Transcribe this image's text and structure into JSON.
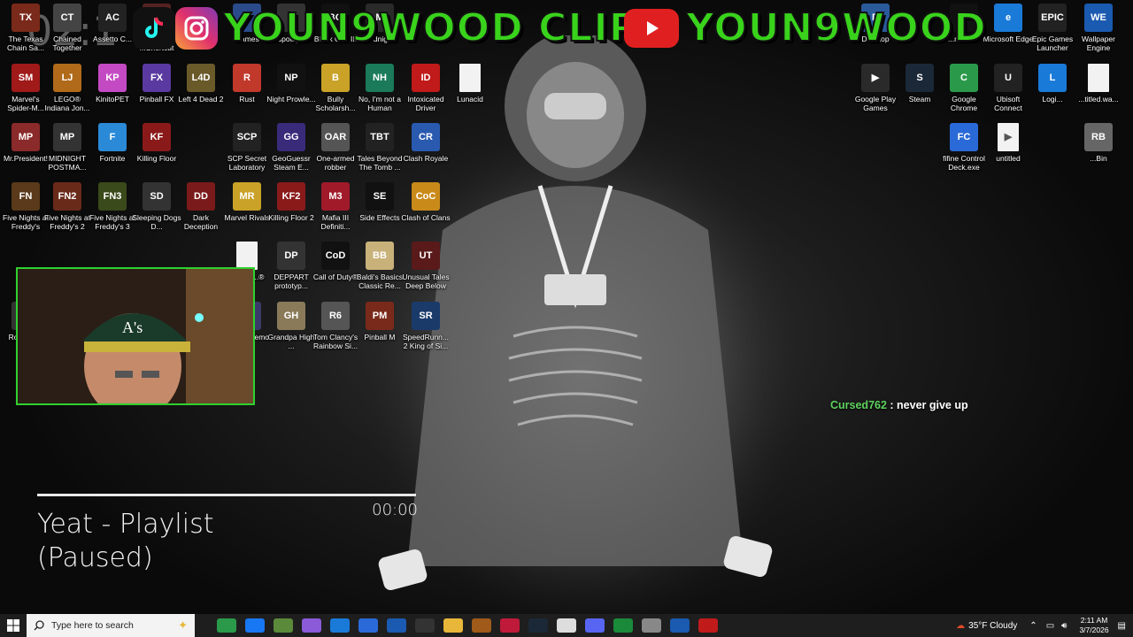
{
  "banner": {
    "brand_left": "YOUN9WOOD CLIPS",
    "brand_right": "YOUN9WOOD",
    "timer": "02:1"
  },
  "desktop_icons": [
    {
      "label": "The Texas Chain Sa...",
      "icon": "texas-chainsaw-icon",
      "color": "#7a2a1a",
      "abbr": "TX"
    },
    {
      "label": "Chained Together",
      "icon": "chained-together-icon",
      "color": "#444",
      "abbr": "CT"
    },
    {
      "label": "Assetto C...",
      "icon": "assetto-corsa-icon",
      "color": "#222",
      "abbr": "AC"
    },
    {
      "label": "Beat ...Shortcut",
      "icon": "beat-shortcut-icon",
      "color": "#552222",
      "abbr": "BS"
    },
    {
      "label": "Games",
      "icon": "games-folder-icon",
      "color": "#2a4a8a",
      "abbr": "G"
    },
    {
      "label": "Spotlight",
      "icon": "spotlight-icon",
      "color": "#333",
      "abbr": "S"
    },
    {
      "label": "Black Ops III",
      "icon": "black-ops-icon",
      "color": "#111",
      "abbr": "BO"
    },
    {
      "label": "Midnig...",
      "icon": "midnight-icon",
      "color": "#2a2a2a",
      "abbr": "M"
    },
    {
      "label": "Marvel's Spider-M...",
      "icon": "spiderman-icon",
      "color": "#a01a1a",
      "abbr": "SM"
    },
    {
      "label": "LEGO® Indiana Jon...",
      "icon": "lego-indiana-icon",
      "color": "#b06a1a",
      "abbr": "LJ"
    },
    {
      "label": "KinitoPET",
      "icon": "kinitopet-icon",
      "color": "#c44ac4",
      "abbr": "KP"
    },
    {
      "label": "Pinball FX",
      "icon": "pinball-fx-icon",
      "color": "#5a3aa0",
      "abbr": "FX"
    },
    {
      "label": "Left 4 Dead 2",
      "icon": "left4dead-icon",
      "color": "#6a5a2a",
      "abbr": "L4D"
    },
    {
      "label": "Rust",
      "icon": "rust-icon",
      "color": "#c0392b",
      "abbr": "R"
    },
    {
      "label": "Night Prowle...",
      "icon": "night-prowler-icon",
      "color": "#111",
      "abbr": "NP"
    },
    {
      "label": "Bully Scholarsh...",
      "icon": "bully-icon",
      "color": "#c9a227",
      "abbr": "B"
    },
    {
      "label": "No, I'm not a Human",
      "icon": "not-human-icon",
      "color": "#1a7a5a",
      "abbr": "NH"
    },
    {
      "label": "Intoxicated Driver",
      "icon": "intoxicated-driver-icon",
      "color": "#c01a1a",
      "abbr": "ID"
    },
    {
      "label": "Lunacid",
      "icon": "file-icon",
      "color": "#f2f2f2",
      "abbr": ""
    },
    {
      "label": "Mr.President!",
      "icon": "mr-president-icon",
      "color": "#8a2a2a",
      "abbr": "MP"
    },
    {
      "label": "MIDNIGHT POSTMA...",
      "icon": "midnight-postman-icon",
      "color": "#333",
      "abbr": "MP"
    },
    {
      "label": "Fortnite",
      "icon": "fortnite-icon",
      "color": "#2a8ad8",
      "abbr": "F"
    },
    {
      "label": "Killing Floor",
      "icon": "killing-floor-icon",
      "color": "#8a1a1a",
      "abbr": "KF"
    },
    {
      "label": "SCP Secret Laboratory",
      "icon": "scp-icon",
      "color": "#222",
      "abbr": "SCP"
    },
    {
      "label": "GeoGuessr Steam E...",
      "icon": "geoguessr-icon",
      "color": "#3a2a7a",
      "abbr": "GG"
    },
    {
      "label": "One-armed robber",
      "icon": "one-armed-robber-icon",
      "color": "#555",
      "abbr": "OAR"
    },
    {
      "label": "Tales Beyond The Tomb ...",
      "icon": "tales-beyond-icon",
      "color": "#222",
      "abbr": "TBT"
    },
    {
      "label": "Clash Royale",
      "icon": "clash-royale-icon",
      "color": "#2a5ab0",
      "abbr": "CR"
    },
    {
      "label": "Five Nights at Freddy's",
      "icon": "fnaf-icon",
      "color": "#5a3a1a",
      "abbr": "FN"
    },
    {
      "label": "Five Nights at Freddy's 2",
      "icon": "fnaf2-icon",
      "color": "#6a2a1a",
      "abbr": "FN2"
    },
    {
      "label": "Five Nights at Freddy's 3",
      "icon": "fnaf3-icon",
      "color": "#3a4a1a",
      "abbr": "FN3"
    },
    {
      "label": "Sleeping Dogs D...",
      "icon": "sleeping-dogs-icon",
      "color": "#333",
      "abbr": "SD"
    },
    {
      "label": "Dark Deception",
      "icon": "dark-deception-icon",
      "color": "#7a1a1a",
      "abbr": "DD"
    },
    {
      "label": "Marvel Rivals",
      "icon": "marvel-rivals-icon",
      "color": "#c9a227",
      "abbr": "MR"
    },
    {
      "label": "Killing Floor 2",
      "icon": "killing-floor2-icon",
      "color": "#8a1a1a",
      "abbr": "KF2"
    },
    {
      "label": "Mafia III Definiti...",
      "icon": "mafia-icon",
      "color": "#a01a2a",
      "abbr": "M3"
    },
    {
      "label": "Side Effects",
      "icon": "side-effects-icon",
      "color": "#111",
      "abbr": "SE"
    },
    {
      "label": "Clash of Clans",
      "icon": "clash-of-clans-icon",
      "color": "#c98a1a",
      "abbr": "CoC"
    },
    {
      "label": "DEPPART prototyp...",
      "icon": "deppart-icon",
      "color": "#333",
      "abbr": "DP"
    },
    {
      "label": "Call of Duty®",
      "icon": "call-of-duty-icon",
      "color": "#111",
      "abbr": "CoD"
    },
    {
      "label": "Baldi's Basics Classic Re...",
      "icon": "baldi-icon",
      "color": "#c9b27a",
      "abbr": "BB"
    },
    {
      "label": "Unusual Tales Deep Below",
      "icon": "unusual-tales-icon",
      "color": "#5a1a1a",
      "abbr": "UT"
    },
    {
      "label": "Grandpa High ...",
      "icon": "grandpa-icon",
      "color": "#8a7a5a",
      "abbr": "GH"
    },
    {
      "label": "Tom Clancy's Rainbow Si...",
      "icon": "rainbow-six-icon",
      "color": "#555",
      "abbr": "R6"
    },
    {
      "label": "Pinball M",
      "icon": "pinball-m-icon",
      "color": "#7a2a1a",
      "abbr": "PM"
    },
    {
      "label": "SpeedRunn... 2 King of Si...",
      "icon": "speedrunners-icon",
      "color": "#1a3a6a",
      "abbr": "SR"
    },
    {
      "label": "Desktop",
      "icon": "desktop-icon",
      "color": "#2a5a9a",
      "abbr": "D"
    },
    {
      "label": "...m Deck",
      "icon": "stream-deck-icon",
      "color": "#111",
      "abbr": "SD"
    },
    {
      "label": "Microsoft Edge",
      "icon": "edge-icon",
      "color": "#1a7ad8",
      "abbr": "e"
    },
    {
      "label": "Epic Games Launcher",
      "icon": "epic-games-icon",
      "color": "#222",
      "abbr": "EPIC"
    },
    {
      "label": "Wallpaper Engine",
      "icon": "wallpaper-engine-icon",
      "color": "#1a5ab0",
      "abbr": "WE"
    },
    {
      "label": "Google Play Games",
      "icon": "google-play-games-icon",
      "color": "#2a2a2a",
      "abbr": "▶"
    },
    {
      "label": "Steam",
      "icon": "steam-icon",
      "color": "#1b2838",
      "abbr": "S"
    },
    {
      "label": "Google Chrome",
      "icon": "chrome-icon",
      "color": "#2a9a4a",
      "abbr": "C"
    },
    {
      "label": "Ubisoft Connect",
      "icon": "ubisoft-icon",
      "color": "#222",
      "abbr": "U"
    },
    {
      "label": "Logi...",
      "icon": "logi-icon",
      "color": "#1a7ad8",
      "abbr": "L"
    },
    {
      "label": "...titled.wa...",
      "icon": "file-icon",
      "color": "#f2f2f2",
      "abbr": ""
    },
    {
      "label": "fifine Control Deck.exe",
      "icon": "fifine-icon",
      "color": "#2a6ad8",
      "abbr": "FC"
    },
    {
      "label": "untitled",
      "icon": "untitled-video-icon",
      "color": "#f2f2f2",
      "abbr": "▶"
    },
    {
      "label": "...Bin",
      "icon": "recycle-bin-icon",
      "color": "#666",
      "abbr": "RB"
    },
    {
      "label": "Ro... Ga...",
      "icon": "roblox-icon",
      "color": "#333",
      "abbr": "R"
    },
    {
      "label": "...al of ...®",
      "icon": "file-icon",
      "color": "#f2f2f2",
      "abbr": ""
    },
    {
      "label": "...kin ...Demo",
      "icon": "demo-icon",
      "color": "#3a3a6a",
      "abbr": "D"
    }
  ],
  "chat": {
    "user": "Cursed762",
    "message": " : never give up"
  },
  "player": {
    "time": "00:00",
    "title_line1": "Yeat - Playlist",
    "title_line2": "(Paused)"
  },
  "taskbar": {
    "search_placeholder": "Type here to search",
    "apps": [
      {
        "icon": "chrome-icon",
        "color": "#2a9a4a"
      },
      {
        "icon": "facebook-icon",
        "color": "#1877f2"
      },
      {
        "icon": "minecraft-icon",
        "color": "#5a8a3a"
      },
      {
        "icon": "copilot-icon",
        "color": "#8a5ad8"
      },
      {
        "icon": "edge-icon",
        "color": "#1a7ad8"
      },
      {
        "icon": "store-icon",
        "color": "#2a6ad8"
      },
      {
        "icon": "mail-icon",
        "color": "#1a5ab0"
      },
      {
        "icon": "obs-icon",
        "color": "#333"
      },
      {
        "icon": "file-explorer-icon",
        "color": "#e8b73a"
      },
      {
        "icon": "game-icon",
        "color": "#a05a1a"
      },
      {
        "icon": "capcut-icon",
        "color": "#c01a3a"
      },
      {
        "icon": "steam-icon",
        "color": "#1b2838"
      },
      {
        "icon": "notepad-icon",
        "color": "#ddd"
      },
      {
        "icon": "discord-icon",
        "color": "#5865f2"
      },
      {
        "icon": "xbox-icon",
        "color": "#1a8a3a"
      },
      {
        "icon": "photos-icon",
        "color": "#888"
      },
      {
        "icon": "wallpaper-engine-icon",
        "color": "#1a5ab0"
      },
      {
        "icon": "rainbow-six-icon",
        "color": "#c01a1a"
      }
    ],
    "weather": "35°F  Cloudy",
    "time": "2:11 AM",
    "date": "3/7/2026"
  }
}
